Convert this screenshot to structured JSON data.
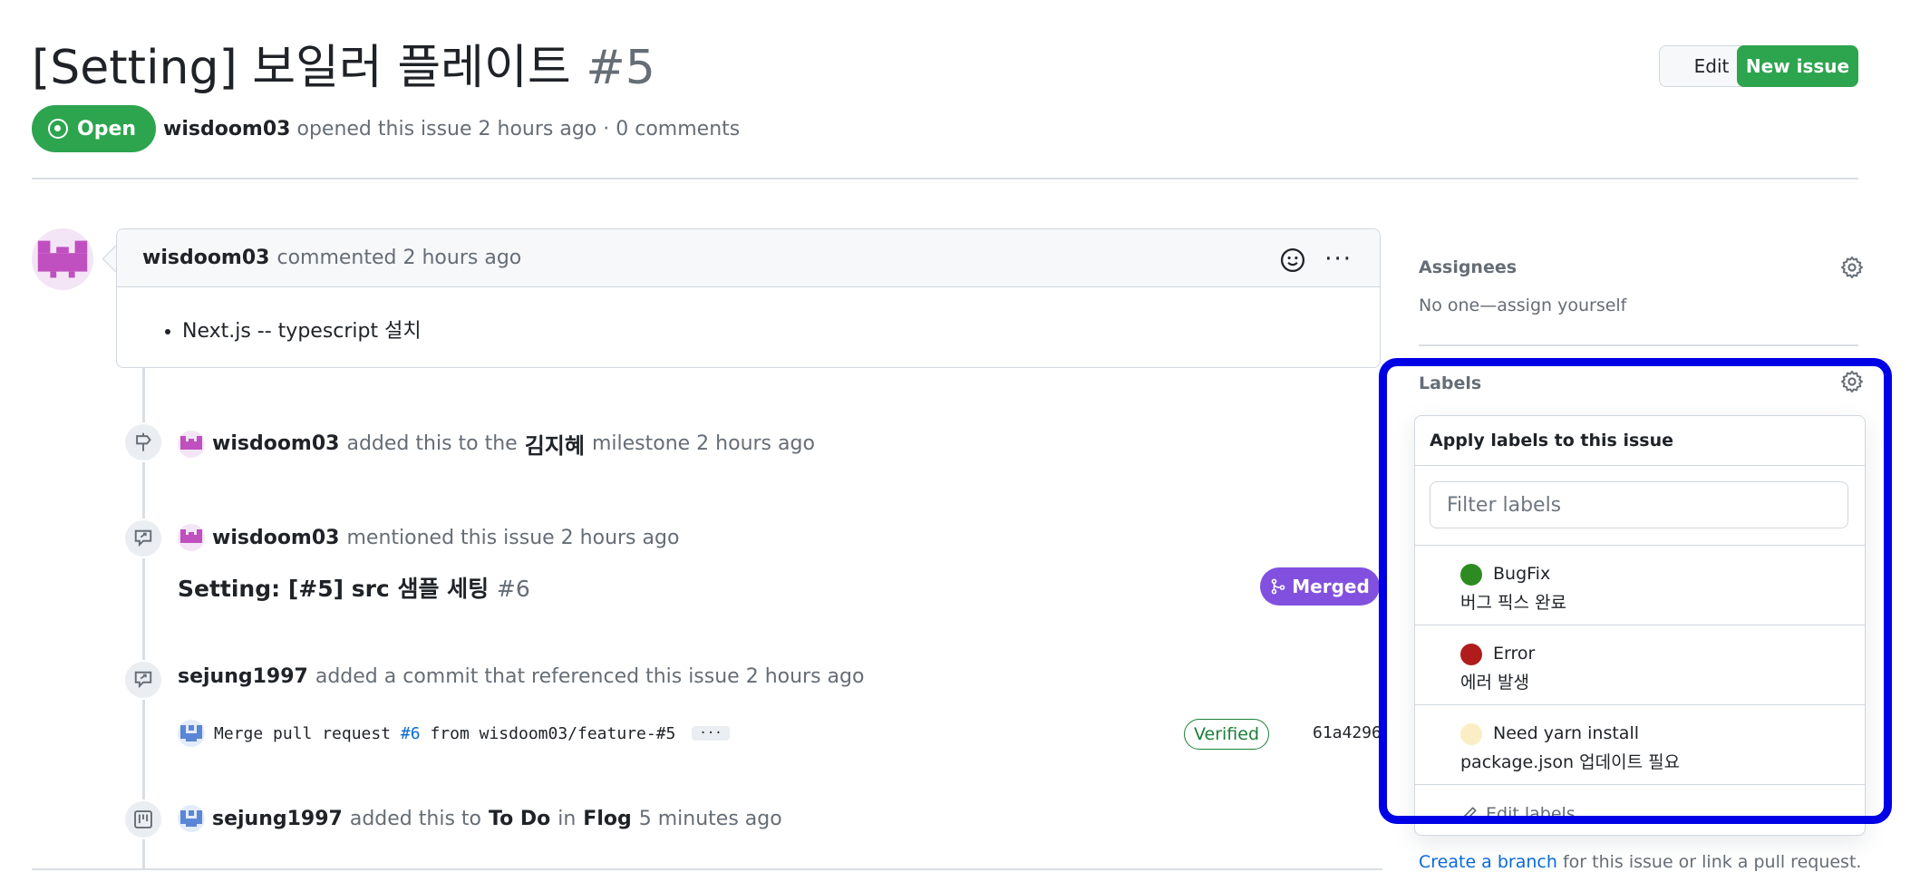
{
  "issue": {
    "title": "[Setting] 보일러 플레이트",
    "number": "#5",
    "state": "Open",
    "author": "wisdoom03",
    "meta_text": "opened this issue 2 hours ago · 0 comments"
  },
  "header_buttons": {
    "edit": "Edit",
    "new_issue": "New issue"
  },
  "comment": {
    "author": "wisdoom03",
    "action": "commented 2 hours ago",
    "body_items": [
      "Next.js -- typescript 설치"
    ],
    "more": "···"
  },
  "timeline": [
    {
      "icon": "milestone-icon",
      "actor": "wisdoom03",
      "pre": "added this to the",
      "target": "김지혜",
      "post": "milestone 2 hours ago"
    },
    {
      "icon": "cross-reference-icon",
      "actor": "wisdoom03",
      "pre": "mentioned this issue 2 hours ago",
      "ref_title": "Setting: [#5] src 샘플 세팅",
      "ref_number": "#6",
      "ref_state": "Merged"
    },
    {
      "icon": "cross-reference-icon",
      "actor": "sejung1997",
      "pre": "added a commit that referenced this issue 2 hours ago",
      "commit_prefix": "Merge pull request",
      "commit_link": "#6",
      "commit_suffix": "from wisdoom03/feature-#5",
      "commit_more": "···",
      "verified": "Verified",
      "sha": "61a4296"
    },
    {
      "icon": "project-icon",
      "actor": "sejung1997",
      "pre": "added this to",
      "target": "To Do",
      "mid": "in",
      "target2": "Flog",
      "post": "5 minutes ago"
    }
  ],
  "sidebar": {
    "assignees": {
      "title": "Assignees",
      "value": "No one—assign yourself"
    },
    "labels": {
      "title": "Labels"
    }
  },
  "label_menu": {
    "title": "Apply labels to this issue",
    "filter_placeholder": "Filter labels",
    "items": [
      {
        "name": "BugFix",
        "description": "버그 픽스 완료",
        "color": "#2e8b22"
      },
      {
        "name": "Error",
        "description": "에러 발생",
        "color": "#b01c1c"
      },
      {
        "name": "Need yarn install",
        "description": "package.json 업데이트 필요",
        "color": "#fbeec5"
      }
    ],
    "edit_labels": "Edit labels"
  },
  "footer": {
    "link": "Create a branch",
    "text": "for this issue or link a pull request."
  },
  "colors": {
    "open_green": "#2da44e",
    "merged_purple": "#8250df",
    "highlight_blue": "#0000e6",
    "link_blue": "#0969da"
  }
}
